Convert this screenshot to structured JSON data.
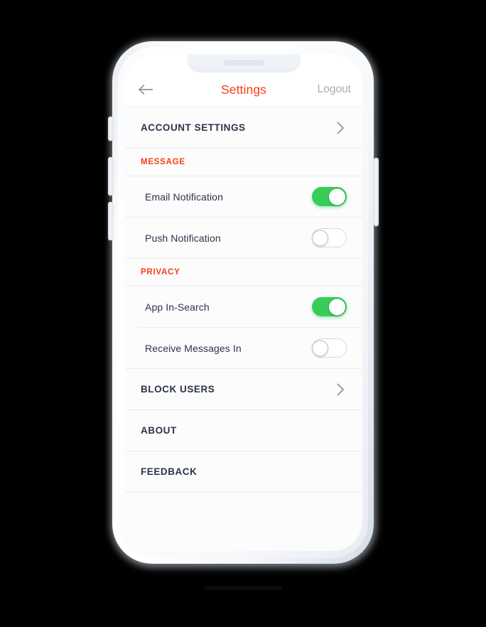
{
  "device": {
    "name": "white-smartphone-mockup",
    "notch_speaker": "speaker-grille",
    "buttons": [
      "silent-switch",
      "volume-up",
      "volume-down",
      "power"
    ]
  },
  "colors": {
    "accent": "#fb3b12",
    "toggle_on": "#38cc5b",
    "toggle_off_border": "#d6d9de",
    "text_primary": "#2b3446",
    "text_muted": "#a7adb5",
    "separator": "#ececf0",
    "list_background": "#fcfcfd"
  },
  "navbar": {
    "back_icon": "arrow-left-icon",
    "title": "Settings",
    "logout_label": "Logout"
  },
  "list": {
    "account_row": {
      "label": "ACCOUNT SETTINGS",
      "chevron_icon": "chevron-right-icon"
    },
    "sections": [
      {
        "header": "MESSAGE",
        "rows": [
          {
            "label": "Email Notification",
            "toggle": "on"
          },
          {
            "label": "Push Notification",
            "toggle": "off"
          }
        ]
      },
      {
        "header": "PRIVACY",
        "rows": [
          {
            "label": "App In-Search",
            "toggle": "on"
          },
          {
            "label": "Receive Messages In",
            "toggle": "off"
          }
        ]
      }
    ],
    "footer_rows": [
      {
        "label": "BLOCK USERS",
        "chevron": true,
        "chevron_icon": "chevron-right-icon"
      },
      {
        "label": "ABOUT",
        "chevron": false
      },
      {
        "label": "FEEDBACK",
        "chevron": false
      }
    ]
  }
}
